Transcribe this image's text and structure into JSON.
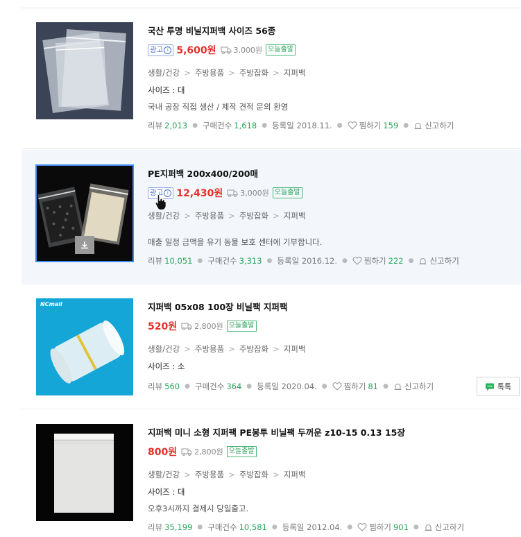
{
  "products": [
    {
      "title": "국산 투명 비닐지퍼백 사이즈 56종",
      "ad_label": "광고",
      "price": "5,600원",
      "shipping": "3,000원",
      "badge": "오늘출발",
      "categories": [
        "생활/건강",
        "주방용품",
        "주방잡화",
        "지퍼백"
      ],
      "size": "사이즈 : 대",
      "desc": "국내 공장 직접 생산 / 제작 견적 문의 환영",
      "review_label": "리뷰",
      "review_count": "2,013",
      "purchase_label": "구매건수",
      "purchase_count": "1,618",
      "reg_label": "등록일",
      "reg_date": "2018.11.",
      "zzim_label": "찜하기",
      "zzim_count": "159",
      "report_label": "신고하기"
    },
    {
      "title": "PE지퍼백 200x400/200매",
      "ad_label": "광고",
      "price": "12,430원",
      "shipping": "3,000원",
      "badge": "오늘출발",
      "categories": [
        "생활/건강",
        "주방용품",
        "주방잡화",
        "지퍼백"
      ],
      "desc": "매출 일정 금액을 유기 동물 보호 센터에 기부합니다.",
      "review_label": "리뷰",
      "review_count": "10,051",
      "purchase_label": "구매건수",
      "purchase_count": "3,313",
      "reg_label": "등록일",
      "reg_date": "2016.12.",
      "zzim_label": "찜하기",
      "zzim_count": "222",
      "report_label": "신고하기"
    },
    {
      "title": "지퍼백 05x08 100장 비닐팩 지퍼팩",
      "price": "520원",
      "shipping": "2,800원",
      "badge": "오늘출발",
      "categories": [
        "생활/건강",
        "주방용품",
        "주방잡화",
        "지퍼백"
      ],
      "size": "사이즈 : 소",
      "review_label": "리뷰",
      "review_count": "560",
      "purchase_label": "구매건수",
      "purchase_count": "364",
      "reg_label": "등록일",
      "reg_date": "2020.04.",
      "zzim_label": "찜하기",
      "zzim_count": "81",
      "report_label": "신고하기",
      "talk_label": "톡톡",
      "thumb_brand": "NCmall"
    },
    {
      "title": "지퍼백 미니 소형 지퍼팩 PE봉투 비닐팩 두꺼운 z10-15 0.13 15장",
      "price": "800원",
      "shipping": "2,800원",
      "badge": "오늘출발",
      "categories": [
        "생활/건강",
        "주방용품",
        "주방잡화",
        "지퍼백"
      ],
      "size": "사이즈 : 대",
      "desc": "오후3시까지 결제시 당일출고.",
      "review_label": "리뷰",
      "review_count": "35,199",
      "purchase_label": "구매건수",
      "purchase_count": "10,581",
      "reg_label": "등록일",
      "reg_date": "2012.04.",
      "zzim_label": "찜하기",
      "zzim_count": "901",
      "report_label": "신고하기"
    }
  ],
  "icons": {
    "ad_info": "info-circle-icon",
    "shipping": "truck-icon",
    "zzim": "heart-icon",
    "report": "siren-icon",
    "download": "download-icon",
    "talk": "chat-bubble-icon"
  },
  "colors": {
    "price": "#e4302b",
    "highlight_bg": "#f3f7fc",
    "green": "#27a35a",
    "ad_blue": "#4a6ec9",
    "selected_border": "#3d8ef0"
  }
}
